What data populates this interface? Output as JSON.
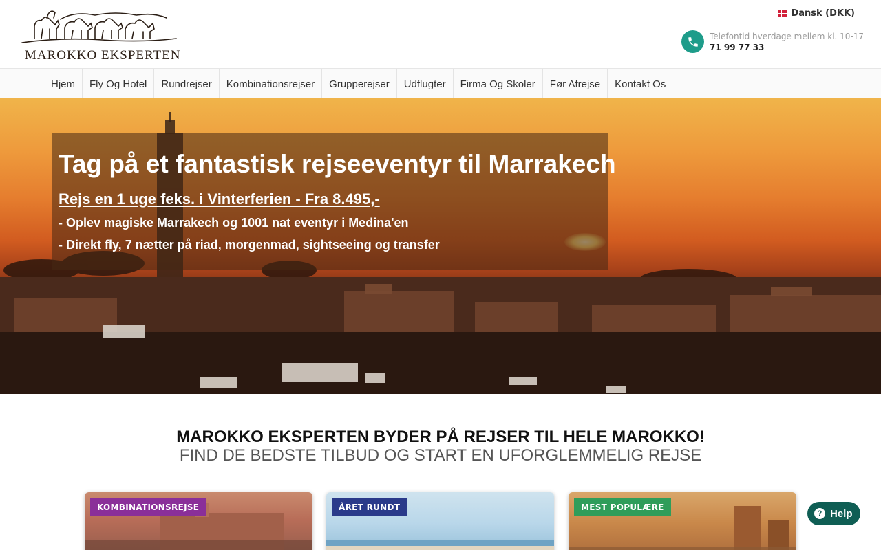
{
  "header": {
    "logo_text": "MAROKKO EKSPERTEN",
    "language": "Dansk (DKK)",
    "phone_hours": "Telefontid hverdage mellem kl. 10-17",
    "phone_number": "71 99 77 33"
  },
  "nav": {
    "items": [
      {
        "label": "Hjem"
      },
      {
        "label": "Fly Og Hotel"
      },
      {
        "label": "Rundrejser"
      },
      {
        "label": "Kombinationsrejser"
      },
      {
        "label": "Grupperejser"
      },
      {
        "label": "Udflugter"
      },
      {
        "label": "Firma Og Skoler"
      },
      {
        "label": "Før Afrejse"
      },
      {
        "label": "Kontakt Os"
      }
    ]
  },
  "hero": {
    "title": "Tag på et fantastisk rejseeventyr til Marrakech",
    "subtitle": "Rejs en 1 uge feks. i Vinterferien - Fra 8.495,-",
    "line1": "- Oplev magiske Marrakech og 1001 nat eventyr i Medina'en",
    "line2": "- Direkt fly, 7 nætter på riad, morgenmad, sightseeing og transfer"
  },
  "section": {
    "title": "MAROKKO EKSPERTEN BYDER PÅ REJSER TIL HELE MAROKKO!",
    "subtitle": "FIND DE BEDSTE TILBUD OG START EN UFORGLEMMELIG REJSE"
  },
  "cards": [
    {
      "badge": "KOMBINATIONSREJSE"
    },
    {
      "badge": "ÅRET RUNDT"
    },
    {
      "badge": "MEST POPULÆRE"
    }
  ],
  "help": {
    "label": "Help"
  },
  "colors": {
    "teal": "#1e9c8a",
    "help_bg": "#0f5e54",
    "badge_purple": "#8a2f99",
    "badge_navy": "#2a3a8a",
    "badge_green": "#2f9d5a"
  },
  "icons": {
    "phone": "phone-icon",
    "flag": "denmark-flag-icon",
    "help": "question-circle-icon"
  }
}
